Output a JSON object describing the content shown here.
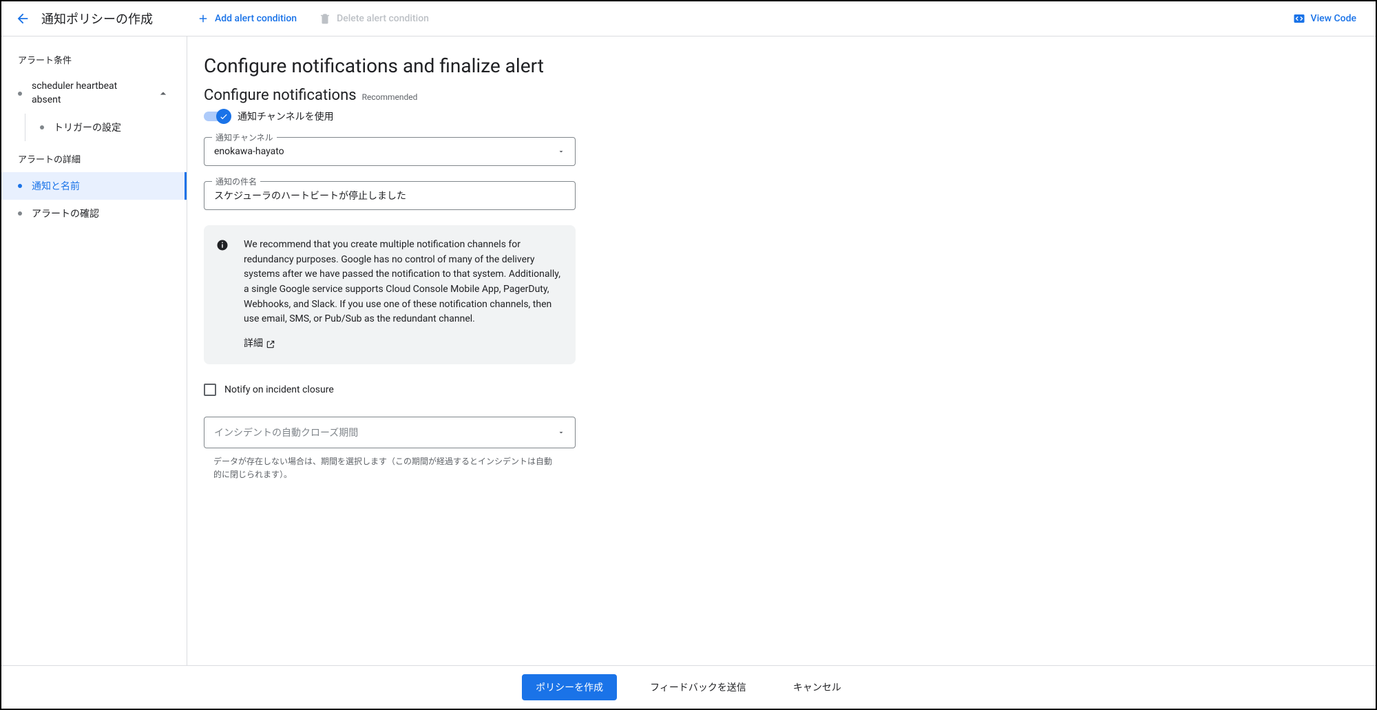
{
  "topbar": {
    "title": "通知ポリシーの作成",
    "add_condition": "Add alert condition",
    "delete_condition": "Delete alert condition",
    "view_code": "View Code"
  },
  "sidebar": {
    "section_conditions": "アラート条件",
    "condition_name": "scheduler heartbeat absent",
    "trigger_config": "トリガーの設定",
    "section_details": "アラートの詳細",
    "notify_and_name": "通知と名前",
    "review_alert": "アラートの確認"
  },
  "main": {
    "h1": "Configure notifications and finalize alert",
    "h2": "Configure notifications",
    "recommended": "Recommended",
    "use_channels": "通知チャンネルを使用",
    "channel_label": "通知チャンネル",
    "channel_value": "enokawa-hayato",
    "subject_label": "通知の件名",
    "subject_value": "スケジューラのハートビートが停止しました",
    "info_text": "We recommend that you create multiple notification channels for redundancy purposes. Google has no control of many of the delivery systems after we have passed the notification to that system. Additionally, a single Google service supports Cloud Console Mobile App, PagerDuty, Webhooks, and Slack. If you use one of these notification channels, then use email, SMS, or Pub/Sub as the redundant channel.",
    "info_more": "詳細",
    "notify_closure": "Notify on incident closure",
    "autoclose_label": "インシデントの自動クローズ期間",
    "autoclose_helper": "データが存在しない場合は、期間を選択します（この期間が経過するとインシデントは自動的に閉じられます）。"
  },
  "footer": {
    "create": "ポリシーを作成",
    "feedback": "フィードバックを送信",
    "cancel": "キャンセル"
  }
}
